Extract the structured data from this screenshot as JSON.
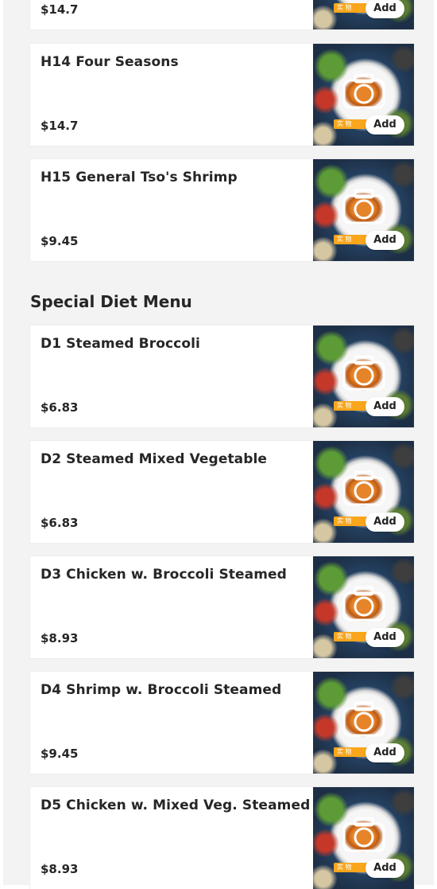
{
  "colors": {
    "panel_bg": "#f3f3f3",
    "card_bg": "#ffffff",
    "tag_bg": "#f5a623"
  },
  "icons": {
    "placeholder": "camera-icon"
  },
  "thumb_tag": "实 物",
  "add_label": "Add",
  "top_items": [
    {
      "name": "",
      "price": "$14.7"
    },
    {
      "name": "H14 Four Seasons",
      "price": "$14.7"
    },
    {
      "name": "H15 General Tso's Shrimp",
      "price": "$9.45"
    }
  ],
  "section": {
    "title": "Special Diet Menu",
    "items": [
      {
        "name": "D1 Steamed Broccoli",
        "price": "$6.83"
      },
      {
        "name": "D2 Steamed Mixed Vegetable",
        "price": "$6.83"
      },
      {
        "name": "D3 Chicken w. Broccoli Steamed",
        "price": "$8.93"
      },
      {
        "name": "D4 Shrimp w. Broccoli Steamed",
        "price": "$9.45"
      },
      {
        "name": "D5 Chicken w. Mixed Veg. Steamed",
        "price": "$8.93"
      }
    ]
  }
}
